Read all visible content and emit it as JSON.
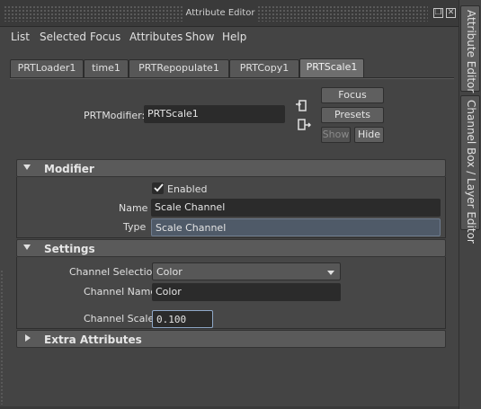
{
  "window": {
    "title": "Attribute Editor"
  },
  "menu": [
    "List",
    "Selected",
    "Focus",
    "Attributes",
    "Show",
    "Help"
  ],
  "tabs": [
    "PRTLoader1",
    "time1",
    "PRTRepopulate1",
    "PRTCopy1",
    "PRTScale1"
  ],
  "active_tab": "PRTScale1",
  "node": {
    "label": "PRTModifier:",
    "value": "PRTScale1"
  },
  "buttons": {
    "focus": "Focus",
    "presets": "Presets",
    "show": "Show",
    "hide": "Hide"
  },
  "modifier": {
    "header": "Modifier",
    "enabled_label": "Enabled",
    "enabled": true,
    "name_label": "Name",
    "name_value": "Scale Channel",
    "type_label": "Type",
    "type_value": "Scale Channel"
  },
  "settings": {
    "header": "Settings",
    "channel_selection_label": "Channel Selection",
    "channel_selection_value": "Color",
    "channel_name_label": "Channel Name",
    "channel_name_value": "Color",
    "channel_scale_label": "Channel Scale",
    "channel_scale_value": "0.100"
  },
  "extra": {
    "header": "Extra Attributes"
  },
  "side_tabs": [
    "Attribute Editor",
    "Channel Box / Layer Editor"
  ],
  "colors": {
    "background": "#444444",
    "field": "#2b2b2b",
    "focus_border": "#8fa8c8",
    "type_field": "#4f5a68"
  }
}
